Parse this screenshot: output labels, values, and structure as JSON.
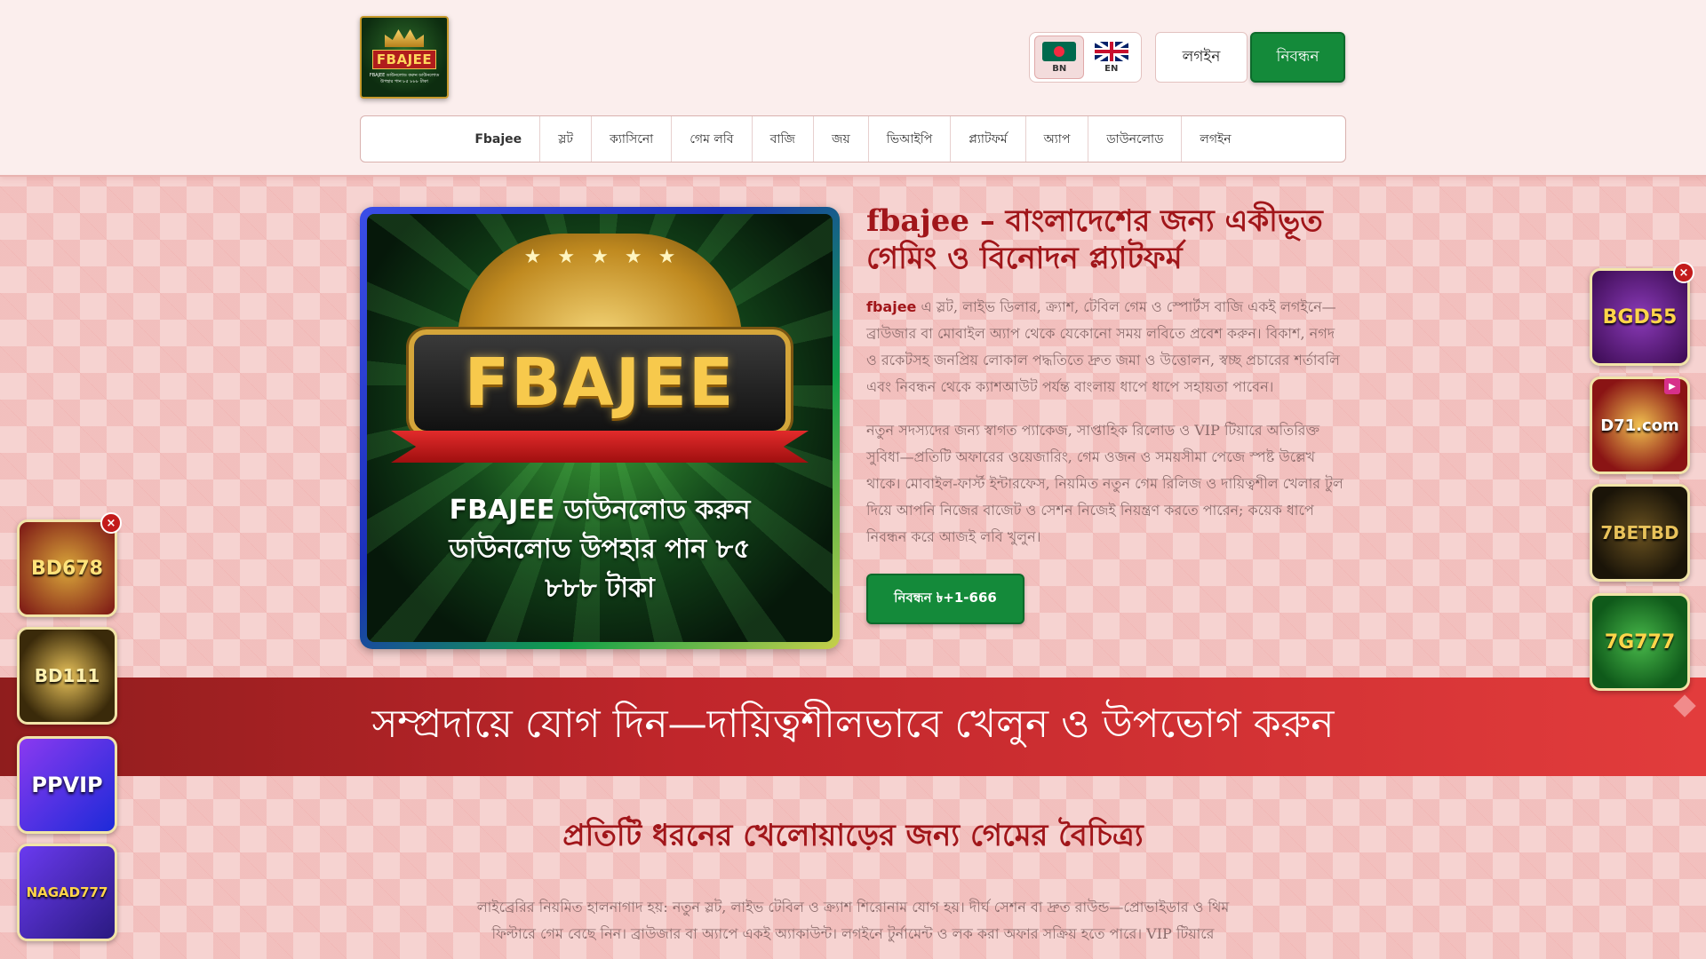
{
  "header": {
    "logo_text": "FBAJEE",
    "logo_subtext": "FBAJEE ডাউনলোড করুন ডাউনলোড উপহার পান ৮৫ ৮৮৮ টাকা",
    "lang": [
      {
        "code": "BN",
        "active": true
      },
      {
        "code": "EN",
        "active": false
      }
    ],
    "login_label": "লগইন",
    "register_label": "নিবন্ধন"
  },
  "nav": {
    "items": [
      "Fbajee",
      "স্লট",
      "ক্যাসিনো",
      "গেম লবি",
      "বাজি",
      "জয়",
      "ভিআইপি",
      "প্ল্যাটফর্ম",
      "অ্যাপ",
      "ডাউনলোড",
      "লগইন"
    ]
  },
  "hero": {
    "image_title": "FBAJEE",
    "image_caption_1": "FBAJEE ডাউনলোড করুন",
    "image_caption_2": "ডাউনলোড উপহার পান ৮৫",
    "image_caption_3": "৮৮৮ টাকা",
    "title": "fbajee – বাংলাদেশের জন্য একীভূত গেমিং ও বিনোদন প্ল্যাটফর্ম",
    "p1_brand": "fbajee",
    "p1_text": " এ স্লট, লাইভ ডিলার, ক্র্যাশ, টেবিল গেম ও স্পোর্টস বাজি একই লগইনে—ব্রাউজার বা মোবাইল অ্যাপ থেকে যেকোনো সময় লবিতে প্রবেশ করুন। বিকাশ, নগদ ও রকেটসহ জনপ্রিয় লোকাল পদ্ধতিতে দ্রুত জমা ও উত্তোলন, স্বচ্ছ প্রচারের শর্তাবলি এবং নিবন্ধন থেকে ক্যাশআউট পর্যন্ত বাংলায় ধাপে ধাপে সহায়তা পাবেন।",
    "p2_text": "নতুন সদস্যদের জন্য স্বাগত প্যাকেজ, সাপ্তাহিক রিলোড ও VIP টিয়ারে অতিরিক্ত সুবিধা—প্রতিটি অফারের ওয়েজারিং, গেম ওজন ও সময়সীমা পেজে স্পষ্ট উল্লেখ থাকে। মোবাইল-ফার্স্ট ইন্টারফেস, নিয়মিত নতুন গেম রিলিজ ও দায়িত্বশীল খেলার টুল দিয়ে আপনি নিজের বাজেট ও সেশন নিজেই নিয়ন্ত্রণ করতে পারেন; কয়েক ধাপে নিবন্ধন করে আজই লবি খুলুন।",
    "cta_label": "নিবন্ধন ৳+1-666"
  },
  "banner": {
    "text": "সম্প্রদায়ে যোগ দিন—দায়িত্বশীলভাবে খেলুন ও উপভোগ করুন"
  },
  "section": {
    "title": "প্রতিটি ধরনের খেলোয়াড়ের জন্য গেমের বৈচিত্র্য",
    "para": "লাইব্রেরির নিয়মিত হালনাগাদ হয়: নতুন স্লট, লাইভ টেবিল ও ক্র্যাশ শিরোনাম যোগ হয়। দীর্ঘ সেশন বা দ্রুত রাউন্ড—প্রোভাইডার ও থিম ফিল্টারে গেম বেছে নিন। ব্রাউজার বা অ্যাপে একই অ্যাকাউন্ট। লগইনে টুর্নামেন্ট ও লক করা অফার সক্রিয় হতে পারে। VIP টিয়ারে"
  },
  "ads_left": [
    {
      "label": "BD678",
      "color": "#7a1414"
    },
    {
      "label": "BD111",
      "color": "#3a2a0a"
    },
    {
      "label": "PPVIP",
      "color": "#3b1fb8"
    },
    {
      "label": "NAGAD777",
      "color": "#3a2390"
    }
  ],
  "ads_right": [
    {
      "label": "BGD55",
      "color": "#5a1a80"
    },
    {
      "label": "D71.com",
      "color": "#8a1414"
    },
    {
      "label": "7BETBD",
      "color": "#1a1408"
    },
    {
      "label": "7G777",
      "color": "#0f5a1a"
    }
  ],
  "close_symbol": "×"
}
